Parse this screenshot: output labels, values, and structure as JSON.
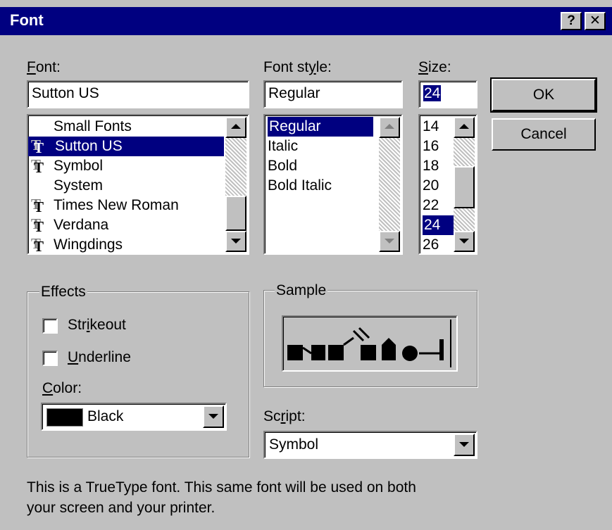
{
  "window": {
    "title": "Font",
    "help_glyph": "?",
    "close_glyph": "✕"
  },
  "font": {
    "label": "Font:",
    "value": "Sutton US",
    "items": [
      {
        "label": "Small Fonts",
        "truetype": false,
        "selected": false
      },
      {
        "label": "Sutton US",
        "truetype": true,
        "selected": true
      },
      {
        "label": "Symbol",
        "truetype": true,
        "selected": false
      },
      {
        "label": "System",
        "truetype": false,
        "selected": false
      },
      {
        "label": "Times New Roman",
        "truetype": true,
        "selected": false
      },
      {
        "label": "Verdana",
        "truetype": true,
        "selected": false
      },
      {
        "label": "Wingdings",
        "truetype": true,
        "selected": false
      }
    ]
  },
  "style": {
    "label": "Font style:",
    "value": "Regular",
    "items": [
      {
        "label": "Regular",
        "selected": true
      },
      {
        "label": "Italic",
        "selected": false
      },
      {
        "label": "Bold",
        "selected": false
      },
      {
        "label": "Bold Italic",
        "selected": false
      }
    ]
  },
  "size": {
    "label": "Size:",
    "value": "24",
    "items": [
      {
        "label": "14",
        "selected": false
      },
      {
        "label": "16",
        "selected": false
      },
      {
        "label": "18",
        "selected": false
      },
      {
        "label": "20",
        "selected": false
      },
      {
        "label": "22",
        "selected": false
      },
      {
        "label": "24",
        "selected": true
      },
      {
        "label": "26",
        "selected": false
      }
    ]
  },
  "buttons": {
    "ok": "OK",
    "cancel": "Cancel"
  },
  "effects": {
    "label": "Effects",
    "strikeout": {
      "label": "Strikeout",
      "checked": false
    },
    "underline": {
      "label": "Underline",
      "checked": false
    },
    "color_label": "Color:",
    "color_value": "Black",
    "color_swatch": "#000000"
  },
  "sample": {
    "label": "Sample"
  },
  "script": {
    "label": "Script:",
    "value": "Symbol"
  },
  "description": {
    "line1": "This is a TrueType font. This same font will be used on both",
    "line2": "your screen and your printer."
  },
  "colors": {
    "titlebar": "#000080",
    "face": "#c0c0c0",
    "selection": "#000080"
  }
}
